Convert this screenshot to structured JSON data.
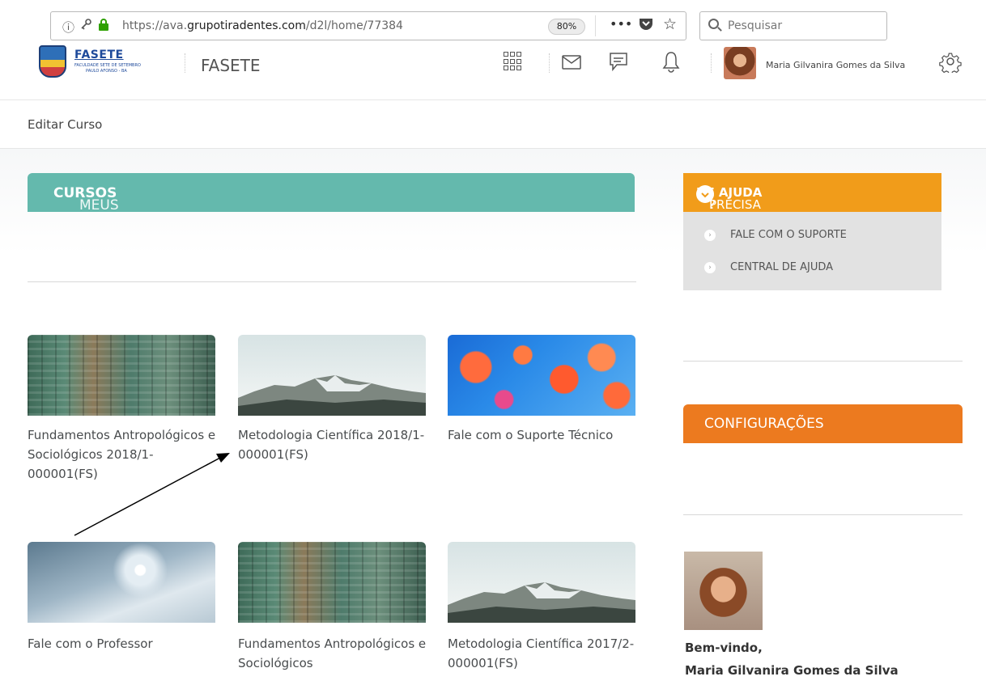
{
  "browser": {
    "url_prefix": "https://ava.",
    "url_domain": "grupotiradentes.com",
    "url_path": "/d2l/home/77384",
    "zoom": "80%",
    "more": "•••",
    "search_placeholder": "Pesquisar"
  },
  "header": {
    "logo_text": "FASETE",
    "logo_tagline": "FACULDADE SETE DE SETEMBRO",
    "logo_location": "PAULO AFONSO - BA",
    "org_name": "FASETE",
    "user_name": "Maria Gilvanira Gomes da Silva"
  },
  "nav": {
    "edit_course": "Editar Curso"
  },
  "my_courses": {
    "title_prefix": "MEUS",
    "title_bold": "CURSOS",
    "courses": [
      {
        "title": "Fundamentos Antropológicos e Sociológicos 2018/1-000001(FS)",
        "image": "wood"
      },
      {
        "title": "Metodologia Científica 2018/1-000001(FS)",
        "image": "mountain"
      },
      {
        "title": "Fale com o Suporte Técnico",
        "image": "jellyfish"
      },
      {
        "title": "Fale com o Professor",
        "image": "snowflake"
      },
      {
        "title": "Fundamentos Antropológicos e Sociológicos",
        "image": "wood"
      },
      {
        "title": "Metodologia Científica 2017/2-000001(FS)",
        "image": "mountain"
      }
    ]
  },
  "help": {
    "title_prefix": "PRECISA",
    "title_bold": "DE AJUDA",
    "title_suffix": "?",
    "items": [
      "FALE COM O SUPORTE",
      "CENTRAL DE AJUDA"
    ]
  },
  "config": {
    "title": "CONFIGURAÇÕES"
  },
  "welcome": {
    "greeting": "Bem-vindo,",
    "name": "Maria Gilvanira Gomes da Silva"
  },
  "colors": {
    "teal": "#64b9ad",
    "help_orange": "#f19c1a",
    "config_orange": "#ec7a1f"
  }
}
